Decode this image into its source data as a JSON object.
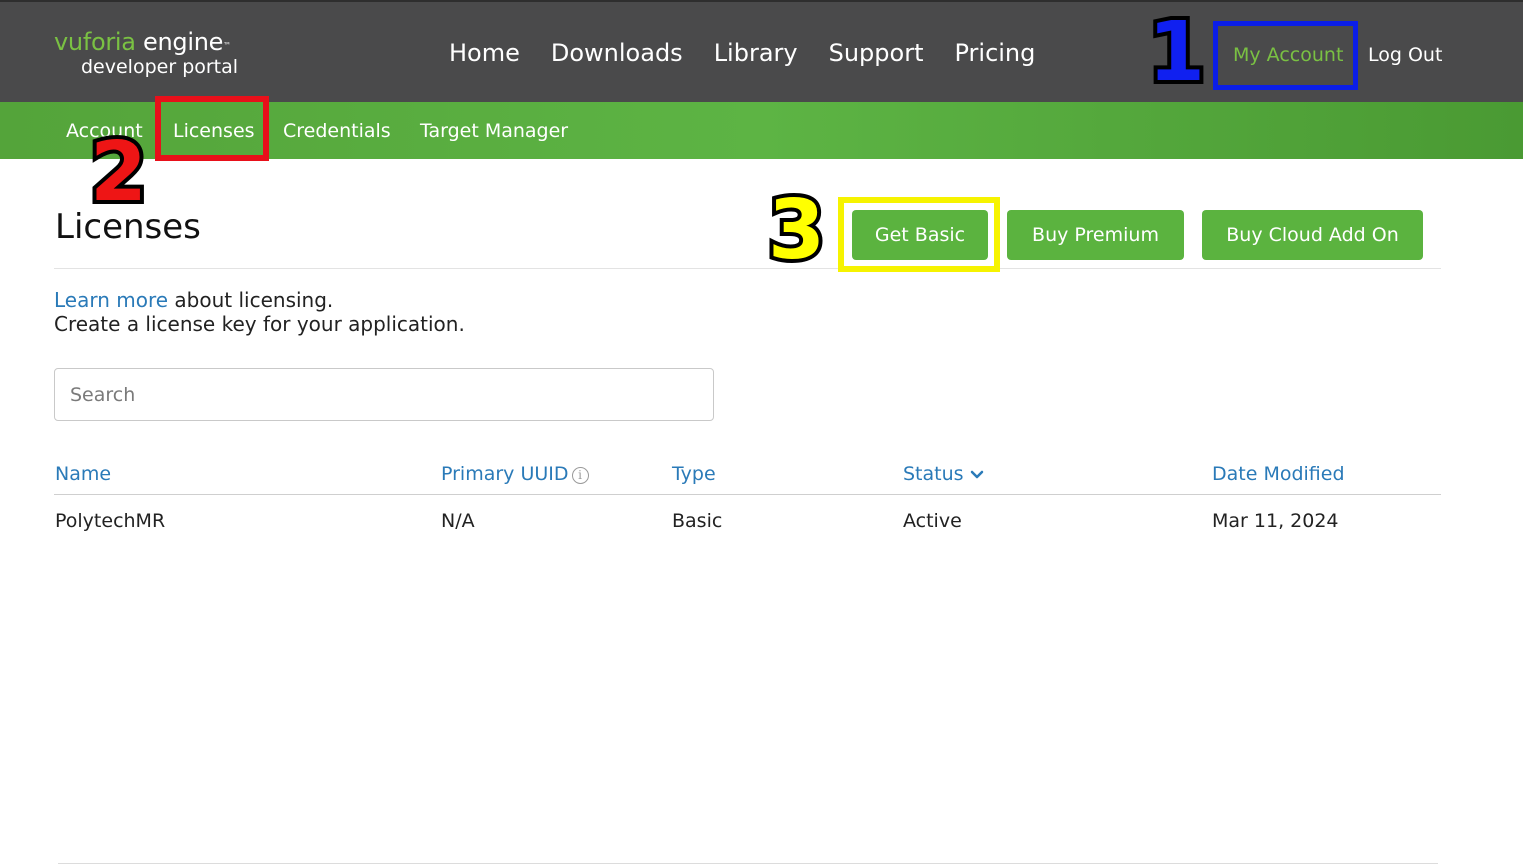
{
  "header": {
    "logo": {
      "brand": "vuforia",
      "product": "engine",
      "tm": "™",
      "subtitle": "developer portal"
    },
    "nav": [
      {
        "label": "Home"
      },
      {
        "label": "Downloads"
      },
      {
        "label": "Library"
      },
      {
        "label": "Support"
      },
      {
        "label": "Pricing"
      }
    ],
    "my_account_label": "My Account",
    "logout_label": "Log Out"
  },
  "subnav": [
    {
      "label": "Account"
    },
    {
      "label": "Licenses",
      "active": true
    },
    {
      "label": "Credentials"
    },
    {
      "label": "Target Manager"
    }
  ],
  "annotations": [
    {
      "number": "1",
      "color": "#0b1ee8",
      "target": "My Account"
    },
    {
      "number": "2",
      "color": "#e8101a",
      "target": "Licenses"
    },
    {
      "number": "3",
      "color": "#f6f300",
      "target": "Get Basic"
    }
  ],
  "main": {
    "title": "Licenses",
    "buttons": {
      "get_basic": "Get Basic",
      "buy_premium": "Buy Premium",
      "buy_cloud": "Buy Cloud Add On"
    },
    "intro": {
      "learn_more": "Learn more",
      "about": " about licensing.",
      "line2": "Create a license key for your application."
    },
    "search": {
      "placeholder": "Search",
      "value": ""
    },
    "table": {
      "columns": [
        "Name",
        "Primary UUID",
        "Type",
        "Status",
        "Date Modified"
      ],
      "sort_column": "Status",
      "rows": [
        {
          "name": "PolytechMR",
          "uuid": "N/A",
          "type": "Basic",
          "status": "Active",
          "date_modified": "Mar 11, 2024"
        }
      ]
    }
  },
  "colors": {
    "header_bg": "#4a4a4b",
    "brand_green": "#5bb33f",
    "link_blue": "#2a7ab8"
  }
}
